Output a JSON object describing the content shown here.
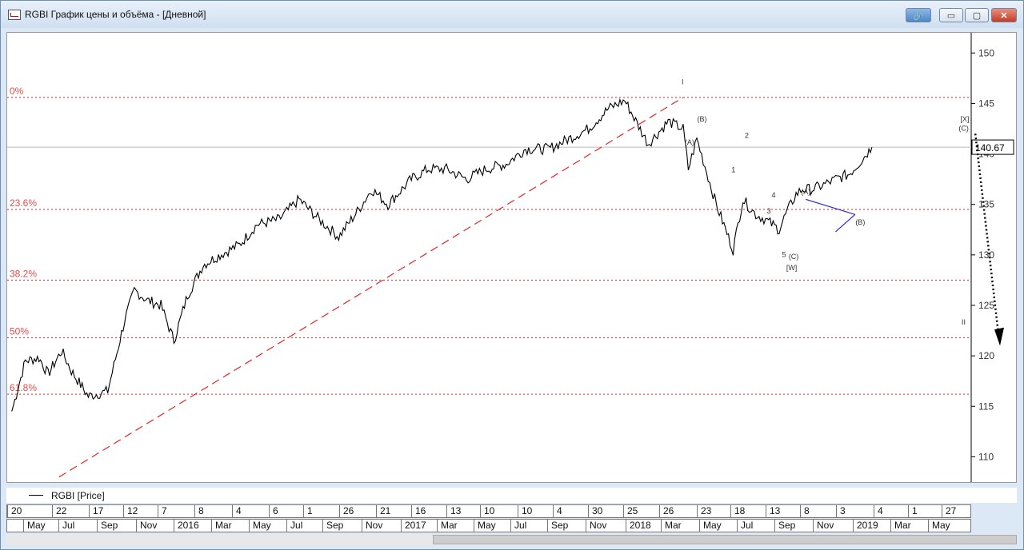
{
  "window": {
    "title": "RGBI График цены и объёма - [Дневной]",
    "buttons": {
      "link": "🔗",
      "minimize": "▭",
      "maximize": "▢",
      "close": "✕"
    }
  },
  "chart_data": {
    "type": "line",
    "title": "RGBI",
    "ylim": [
      107.5,
      152
    ],
    "y_ticks": [
      110,
      115,
      120,
      125,
      130,
      135,
      140,
      145,
      150
    ],
    "grid": false,
    "last_price": "140.67",
    "x": [
      "2015-05-20",
      "2015-06-10",
      "2015-07-01",
      "2015-07-15",
      "2015-08-05",
      "2015-08-20",
      "2015-09-15",
      "2015-10-15",
      "2015-11-10",
      "2015-11-25",
      "2015-12-15",
      "2016-01-05",
      "2016-01-25",
      "2016-02-15",
      "2016-03-10",
      "2016-04-05",
      "2016-05-05",
      "2016-06-01",
      "2016-07-05",
      "2016-08-05",
      "2016-09-05",
      "2016-10-05",
      "2016-11-05",
      "2016-11-25",
      "2016-12-20",
      "2017-01-25",
      "2017-02-20",
      "2017-03-20",
      "2017-04-20",
      "2017-05-20",
      "2017-06-20",
      "2017-07-20",
      "2017-08-25",
      "2017-09-25",
      "2017-10-25",
      "2017-11-25",
      "2017-12-20",
      "2018-01-25",
      "2018-02-25",
      "2018-03-20",
      "2018-03-28",
      "2018-04-10",
      "2018-05-10",
      "2018-06-05",
      "2018-06-20",
      "2018-07-10",
      "2018-07-25",
      "2018-08-15",
      "2018-08-25",
      "2018-09-10",
      "2018-09-20",
      "2018-10-05",
      "2018-10-25",
      "2018-11-10",
      "2018-12-01",
      "2018-12-15",
      "2019-01-05",
      "2019-01-25",
      "2019-02-20",
      "2019-03-20",
      "2019-04-20",
      "2019-05-15",
      "2019-06-01"
    ],
    "values": [
      114.5,
      119.5,
      119.8,
      118.2,
      120.5,
      118.5,
      116.0,
      116.5,
      123.5,
      126.5,
      125.5,
      125.0,
      121.5,
      126.0,
      129.0,
      130.0,
      131.0,
      133.0,
      133.5,
      135.5,
      133.5,
      131.8,
      134.5,
      136.5,
      135.0,
      137.5,
      138.5,
      138.5,
      137.5,
      138.5,
      139.0,
      140.5,
      140.5,
      141.5,
      142.5,
      144.5,
      145.3,
      141.0,
      143.2,
      142.5,
      138.5,
      141.5,
      135.0,
      130.5,
      135.5,
      134.0,
      133.5,
      132.5,
      134.0,
      136.0,
      136.5,
      136.5,
      137.0,
      137.5,
      138.0,
      139.0,
      140.67
    ],
    "fibonacci": [
      {
        "label": "0%",
        "value": 145.6
      },
      {
        "label": "23.6%",
        "value": 134.5
      },
      {
        "label": "38.2%",
        "value": 127.5
      },
      {
        "label": "50%",
        "value": 121.8
      },
      {
        "label": "61.8%",
        "value": 116.2
      }
    ],
    "current_price_line": 140.67,
    "annotations": [
      "I",
      "(A)",
      "(B)",
      "1",
      "2",
      "3",
      "4",
      "5",
      "(C)",
      "[W]",
      "(A)",
      "(B)",
      "[X]",
      "(C)",
      "II"
    ],
    "x_axis_days": [
      "20",
      "22",
      "17",
      "12",
      "7",
      "8",
      "4",
      "6",
      "1",
      "26",
      "21",
      "16",
      "13",
      "10",
      "10",
      "4",
      "30",
      "25",
      "26",
      "23",
      "18",
      "13",
      "8",
      "3",
      "4",
      "1",
      "27"
    ],
    "x_axis_months": [
      "May",
      "Jul",
      "Sep",
      "Nov",
      "2016",
      "Mar",
      "May",
      "Jul",
      "Sep",
      "Nov",
      "2017",
      "Mar",
      "May",
      "Jul",
      "Sep",
      "Nov",
      "2018",
      "Mar",
      "May",
      "Jul",
      "Sep",
      "Nov",
      "2019",
      "Mar",
      "May"
    ]
  },
  "legend": {
    "label": "RGBI [Price]"
  },
  "colors": {
    "fib_line": "#e2262a",
    "fib_label": "#e84c4c",
    "price": "#000000",
    "trendline": "#e2262a",
    "triangle": "#2b2bd4"
  }
}
